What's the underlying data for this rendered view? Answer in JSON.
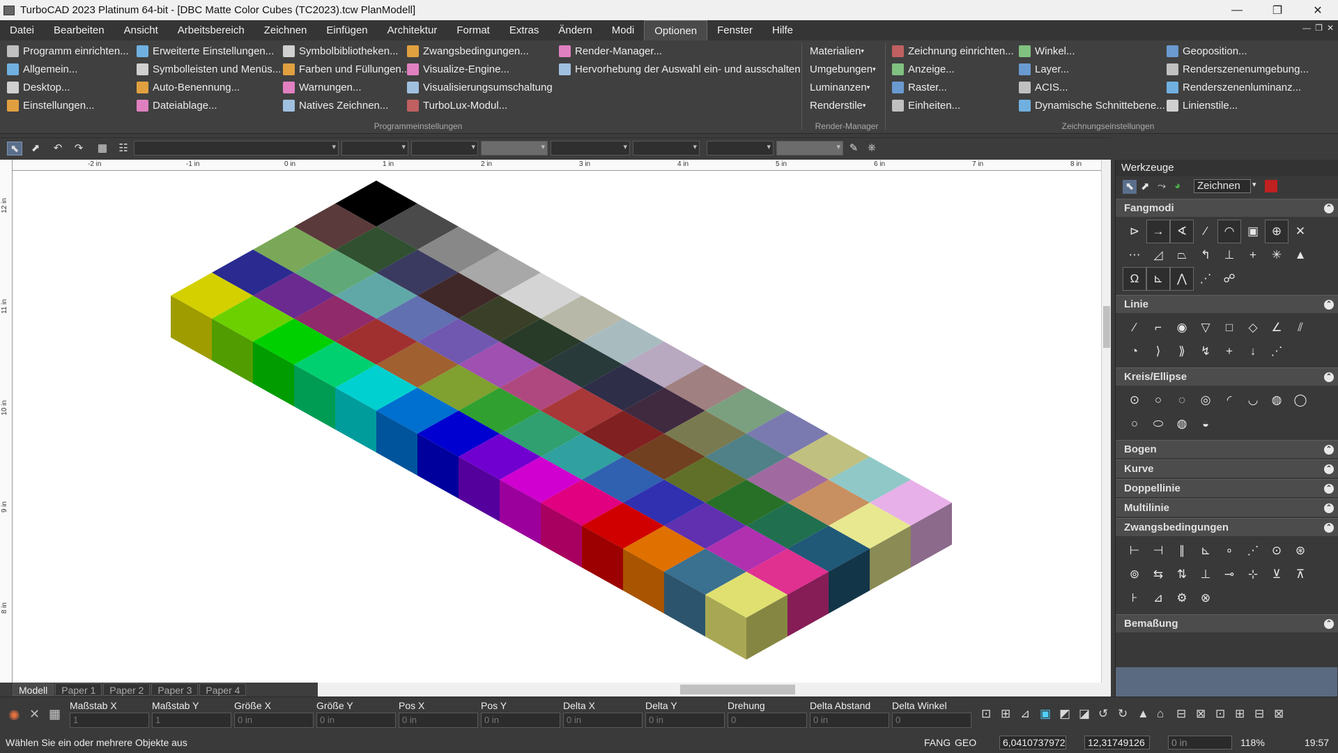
{
  "window": {
    "title": "TurboCAD 2023 Platinum 64-bit - [DBC Matte Color Cubes (TC2023).tcw PlanModell]",
    "controls": [
      "—",
      "❐",
      "✕"
    ]
  },
  "menu": [
    "Datei",
    "Bearbeiten",
    "Ansicht",
    "Arbeitsbereich",
    "Zeichnen",
    "Einfügen",
    "Architektur",
    "Format",
    "Extras",
    "Ändern",
    "Modi",
    "Optionen",
    "Fenster",
    "Hilfe"
  ],
  "menu_active": "Optionen",
  "ribbon": {
    "col1": [
      "Programm einrichten...",
      "Allgemein...",
      "Desktop...",
      "Einstellungen..."
    ],
    "col2": [
      "Erweiterte Einstellungen...",
      "Symbolleisten und Menüs...",
      "Auto-Benennung...",
      "Dateiablage..."
    ],
    "col3": [
      "Symbolbibliotheken...",
      "Farben und Füllungen...",
      "Warnungen...",
      "Natives Zeichnen..."
    ],
    "col4": [
      "Zwangsbedingungen...",
      "Visualize-Engine...",
      "Visualisierungsumschaltung",
      "TurboLux-Modul..."
    ],
    "col5": [
      "Render-Manager...",
      "Hervorhebung der Auswahl ein- und ausschalten"
    ],
    "col6": [
      "Materialien",
      "Umgebungen",
      "Luminanzen",
      "Renderstile"
    ],
    "col7": [
      "Zeichnung einrichten...",
      "Anzeige...",
      "Raster...",
      "Einheiten..."
    ],
    "col8": [
      "Winkel...",
      "Layer...",
      "ACIS...",
      "Dynamische Schnittebene..."
    ],
    "col9": [
      "Geoposition...",
      "Renderszenenumgebung...",
      "Renderszenenluminanz...",
      "Linienstile..."
    ],
    "groups": [
      "Programmeinstellungen",
      "Render-Manager",
      "Zeichnungseinstellungen"
    ]
  },
  "ruler_h": [
    "-2 in",
    "-1 in",
    "0 in",
    "1 in",
    "2 in",
    "3 in",
    "4 in",
    "5 in",
    "6 in",
    "7 in",
    "8 in"
  ],
  "ruler_v": [
    "12 in",
    "11 in",
    "10 in",
    "9 in",
    "8 in"
  ],
  "tabs": [
    "Modell",
    "Paper 1",
    "Paper 2",
    "Paper 3",
    "Paper 4"
  ],
  "inspector": {
    "labels": [
      "Maßstab X",
      "Maßstab Y",
      "Größe X",
      "Größe Y",
      "Pos X",
      "Pos Y",
      "Delta X",
      "Delta Y",
      "Drehung",
      "Delta Abstand",
      "Delta Winkel"
    ],
    "values": [
      "1",
      "1",
      "0 in",
      "0 in",
      "0 in",
      "0 in",
      "0 in",
      "0 in",
      "0",
      "0 in",
      "0"
    ]
  },
  "status": {
    "message": "Wählen Sie ein oder mehrere Objekte aus",
    "fang": "FANG",
    "geo": "GEO",
    "x": "6,0410737972",
    "y": "12,31749126",
    "z": "0 in",
    "zoom": "118%",
    "time": "19:57"
  },
  "panel": {
    "title": "Werkzeuge",
    "mode": "Zeichnen",
    "sections": [
      "Fangmodi",
      "Linie",
      "Kreis/Ellipse",
      "Bogen",
      "Kurve",
      "Doppellinie",
      "Multilinie",
      "Zwangsbedingungen",
      "Bemaßung"
    ]
  },
  "icons": {
    "fang": [
      "⊳",
      "→",
      "∢",
      "∕",
      "◠",
      "▣",
      "⊕",
      "✕",
      "⋯",
      "◿",
      "⏢",
      "↰",
      "⊥",
      "+",
      "✳",
      "▲",
      "Ω",
      "⊾",
      "⋀",
      "⋰",
      "☍"
    ],
    "linie": [
      "∕",
      "⌐",
      "◉",
      "▽",
      "□",
      "◇",
      "∠",
      "⫽",
      "◔",
      "⟩",
      "⟫",
      "↯",
      "+",
      "↓",
      "⋰"
    ],
    "kreis": [
      "⊙",
      "○",
      "◌",
      "◎",
      "◜",
      "◡",
      "◍",
      "◯",
      "○",
      "⬭",
      "◍",
      "◒"
    ],
    "zwang": [
      "⊢",
      "⊣",
      "∥",
      "⊾",
      "∘",
      "⋰",
      "⊙",
      "⊛",
      "⊚",
      "⇆",
      "⇅",
      "⊥",
      "⊸",
      "⊹",
      "⊻",
      "⊼",
      "⊦",
      "⊿",
      "⚙",
      "⊗"
    ]
  },
  "colors": {
    "accent": "#5a6f8c",
    "bg": "#3c3c3c",
    "canvas": "#ffffff"
  },
  "grid_colors": [
    [
      "#000000",
      "#4a4a4a",
      "#888888",
      "#a8a8a8",
      "#d4d4d4",
      "#b8b8a8",
      "#a8bcc0",
      "#b8a8c0",
      "#a08080",
      "#7aa080",
      "#7a7ab0",
      "#c0c080",
      "#90c8c8",
      "#e8b0e8"
    ],
    [
      "#5a3a3a",
      "#305030",
      "#3a3a60",
      "#402828",
      "#3a4028",
      "#283a28",
      "#283a3a",
      "#2e2e48",
      "#402a40",
      "#7a7a50",
      "#508088",
      "#a06aa0",
      "#c89060",
      "#e8e890"
    ],
    [
      "#7aa858",
      "#60a878",
      "#60a8a8",
      "#6070b0",
      "#7058b0",
      "#a050b0",
      "#b04880",
      "#a83838",
      "#802020",
      "#704020",
      "#607028",
      "#287028",
      "#207050",
      "#205878"
    ],
    [
      "#2a2a90",
      "#6a2a90",
      "#902a6a",
      "#a03030",
      "#a06030",
      "#80a030",
      "#30a030",
      "#30a070",
      "#30a0a0",
      "#3060b0",
      "#3030b0",
      "#6030b0",
      "#b030b0",
      "#e03090"
    ],
    [
      "#d4d000",
      "#6cd000",
      "#00d000",
      "#00d070",
      "#00d0d0",
      "#0070d0",
      "#0000d0",
      "#7000d0",
      "#d000d0",
      "#e00080",
      "#d00000",
      "#e07000",
      "#3a7090",
      "#e0e070"
    ]
  ]
}
